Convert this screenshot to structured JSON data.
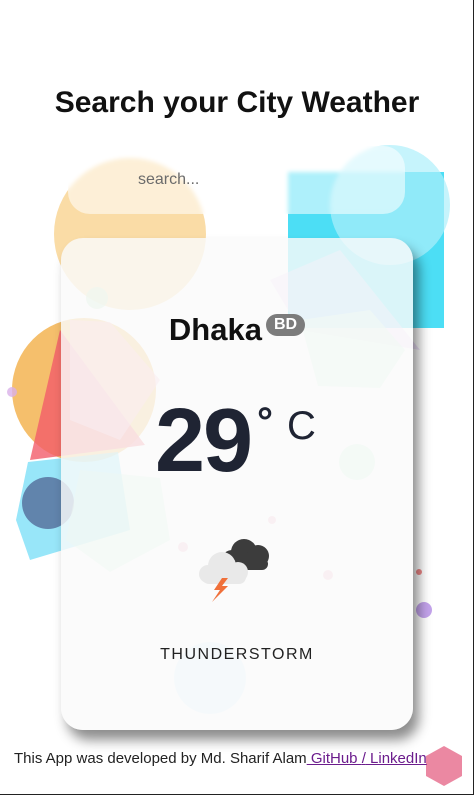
{
  "header": {
    "title": "Search your City Weather"
  },
  "search": {
    "placeholder": "search..."
  },
  "weather": {
    "city": "Dhaka",
    "country": "BD",
    "temperature": "29",
    "degree_symbol": "°",
    "unit": "C",
    "condition": "THUNDERSTORM",
    "icon": "thunderstorm-icon"
  },
  "footer": {
    "text": "This App was developed by Md. Sharif Alam",
    "github_label": " GitHub ",
    "separator": "/",
    "linkedin_label": " LinkedIn"
  }
}
